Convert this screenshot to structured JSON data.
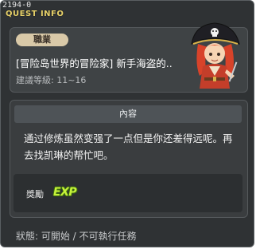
{
  "window": {
    "quest_id": "2194-0",
    "title": "QUEST INFO"
  },
  "quest": {
    "category": "職業",
    "title": "[冒险岛世界的冒险家] 新手海盗的..",
    "level": "建議等級: 11~16",
    "portrait_icon": "pirate-npc-portrait"
  },
  "detail": {
    "header": "內容",
    "description": "通过修炼虽然变强了一点但是你还差得远呢。再去找凯琳的帮忙吧。",
    "reward_label": "獎勵",
    "reward_icon_text": "EXP"
  },
  "status": {
    "text": "狀態:  可開始  / 不可執行任務"
  },
  "colors": {
    "window_bg": "#2f3234",
    "title_accent": "#e8d26a",
    "badge_bg": "#d9c9a8",
    "exp_green": "#c6f23a"
  }
}
